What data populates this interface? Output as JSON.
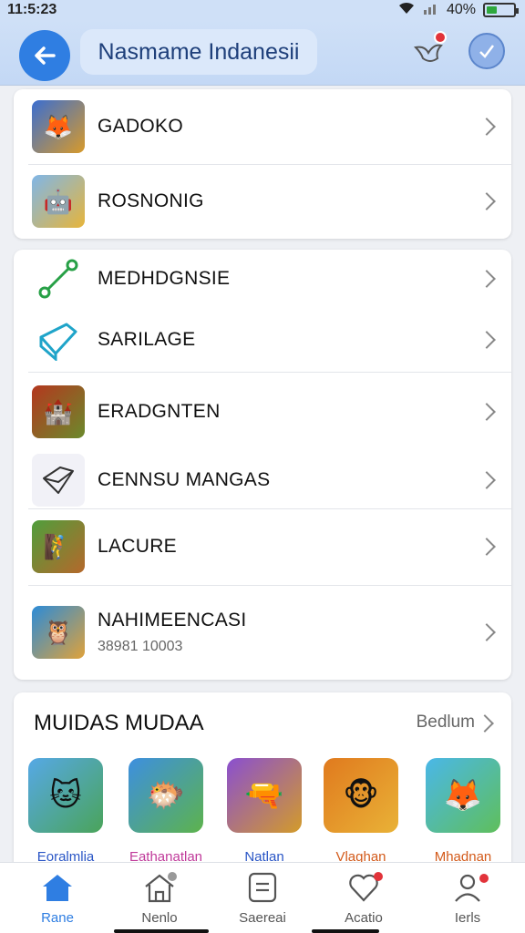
{
  "status": {
    "time": "11:5:23",
    "battery": "40%",
    "battery_level": 0.4
  },
  "header": {
    "title": "Nasmame Indanesii"
  },
  "group1": [
    {
      "label": "GADOKO",
      "icon": "game-thumb-icon"
    },
    {
      "label": "ROSNONIG",
      "icon": "game-thumb-icon"
    }
  ],
  "group2": [
    {
      "label": "MEDHDGNSIE",
      "icon": "link-icon"
    },
    {
      "label": "SARILAGE",
      "icon": "pencil-box-icon"
    },
    {
      "label": "ERADGNTEN",
      "icon": "game-thumb-icon"
    },
    {
      "label": "CENNSU MANGAS",
      "icon": "edit-icon"
    },
    {
      "label": "LACURE",
      "icon": "game-thumb-icon"
    },
    {
      "label": "NAHIMEENCASI",
      "sub": "38981 10003",
      "icon": "game-thumb-icon"
    }
  ],
  "section": {
    "title": "MUIDAS MUDAA",
    "link": "Bedlum",
    "tiles": [
      {
        "label": "Eoralmlia",
        "color": "#2a56c6"
      },
      {
        "label": "Eathanatlan",
        "color": "#c03a9a"
      },
      {
        "label": "Natlan",
        "color": "#2a56c6"
      },
      {
        "label": "Vlaghan",
        "color": "#d35a1a"
      },
      {
        "label": "Mhadnan",
        "color": "#d35a1a"
      }
    ]
  },
  "nav": [
    {
      "label": "Rane",
      "icon": "home-icon"
    },
    {
      "label": "Nenlo",
      "icon": "house-outline-icon"
    },
    {
      "label": "Saereai",
      "icon": "document-icon"
    },
    {
      "label": "Acatio",
      "icon": "heart-icon"
    },
    {
      "label": "Ierls",
      "icon": "person-icon"
    }
  ]
}
